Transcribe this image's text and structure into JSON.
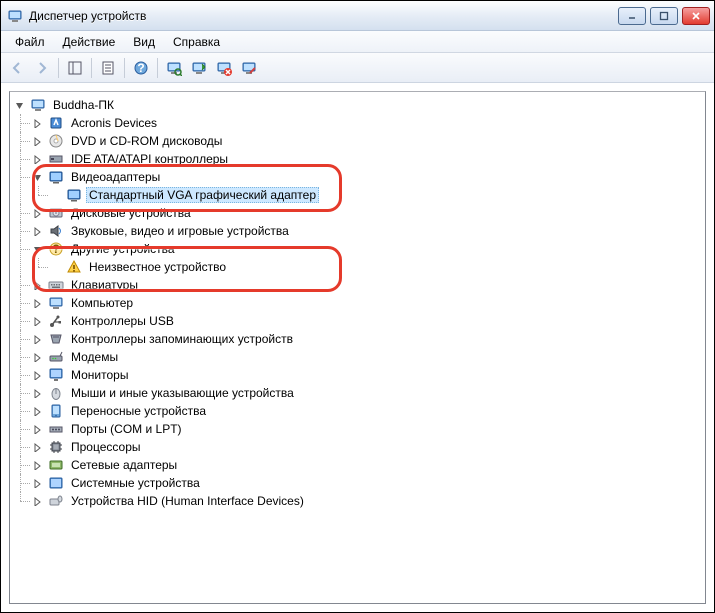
{
  "window": {
    "title": "Диспетчер устройств"
  },
  "menu": {
    "file": "Файл",
    "action": "Действие",
    "view": "Вид",
    "help": "Справка"
  },
  "tree": {
    "root": "Buddha-ПК",
    "nodes": {
      "acronis": "Acronis Devices",
      "dvd": "DVD и CD-ROM дисководы",
      "ide": "IDE ATA/ATAPI контроллеры",
      "video": "Видеоадаптеры",
      "video_vga": "Стандартный VGA графический адаптер",
      "disk": "Дисковые устройства",
      "sound": "Звуковые, видео и игровые устройства",
      "other": "Другие устройства",
      "other_unknown": "Неизвестное устройство",
      "keyboards": "Клавиатуры",
      "computer": "Компьютер",
      "usb": "Контроллеры USB",
      "storage": "Контроллеры запоминающих устройств",
      "modem": "Модемы",
      "monitors": "Мониторы",
      "mouse": "Мыши и иные указывающие устройства",
      "portable": "Переносные устройства",
      "ports": "Порты (COM и LPT)",
      "cpu": "Процессоры",
      "network": "Сетевые адаптеры",
      "system": "Системные устройства",
      "hid": "Устройства HID (Human Interface Devices)"
    }
  }
}
